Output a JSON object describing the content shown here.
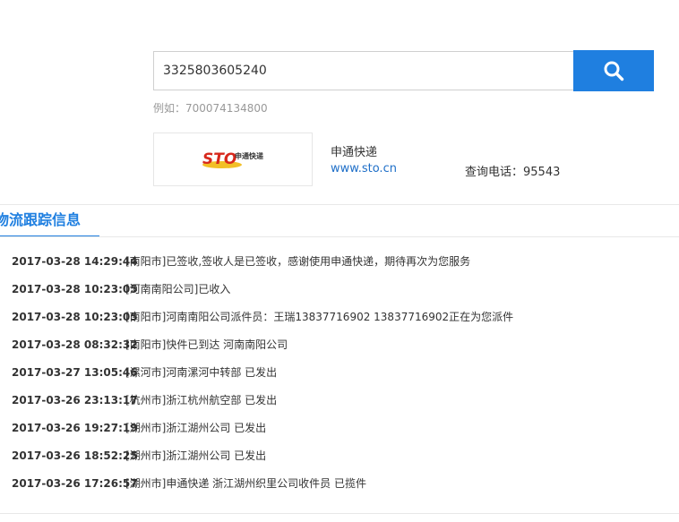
{
  "search": {
    "value": "3325803605240",
    "example": "例如：700074134800"
  },
  "company": {
    "logo_text": "STO",
    "logo_sub": "申通快递",
    "name": "申通快递",
    "website": "www.sto.cn",
    "phone": "查询电话：95543"
  },
  "section": {
    "title": "物流跟踪信息"
  },
  "tracking": [
    {
      "time": "2017-03-28 14:29:44",
      "desc": "[南阳市]已签收,签收人是已签收，感谢使用申通快递，期待再次为您服务"
    },
    {
      "time": "2017-03-28 10:23:05",
      "desc": "[河南南阳公司]已收入"
    },
    {
      "time": "2017-03-28 10:23:05",
      "desc": "[南阳市]河南南阳公司派件员：王瑞13837716902 13837716902正在为您派件"
    },
    {
      "time": "2017-03-28 08:32:32",
      "desc": "[南阳市]快件已到达 河南南阳公司"
    },
    {
      "time": "2017-03-27 13:05:46",
      "desc": "[漯河市]河南漯河中转部 已发出"
    },
    {
      "time": "2017-03-26 23:13:17",
      "desc": "[杭州市]浙江杭州航空部 已发出"
    },
    {
      "time": "2017-03-26 19:27:19",
      "desc": "[湖州市]浙江湖州公司 已发出"
    },
    {
      "time": "2017-03-26 18:52:25",
      "desc": "[湖州市]浙江湖州公司 已发出"
    },
    {
      "time": "2017-03-26 17:26:57",
      "desc": "[湖州市]申通快递 浙江湖州织里公司收件员 已揽件"
    }
  ],
  "colors": {
    "accent": "#1f7fe0",
    "logo_red": "#d7281c"
  },
  "icons": {
    "search_button": "search-icon"
  }
}
